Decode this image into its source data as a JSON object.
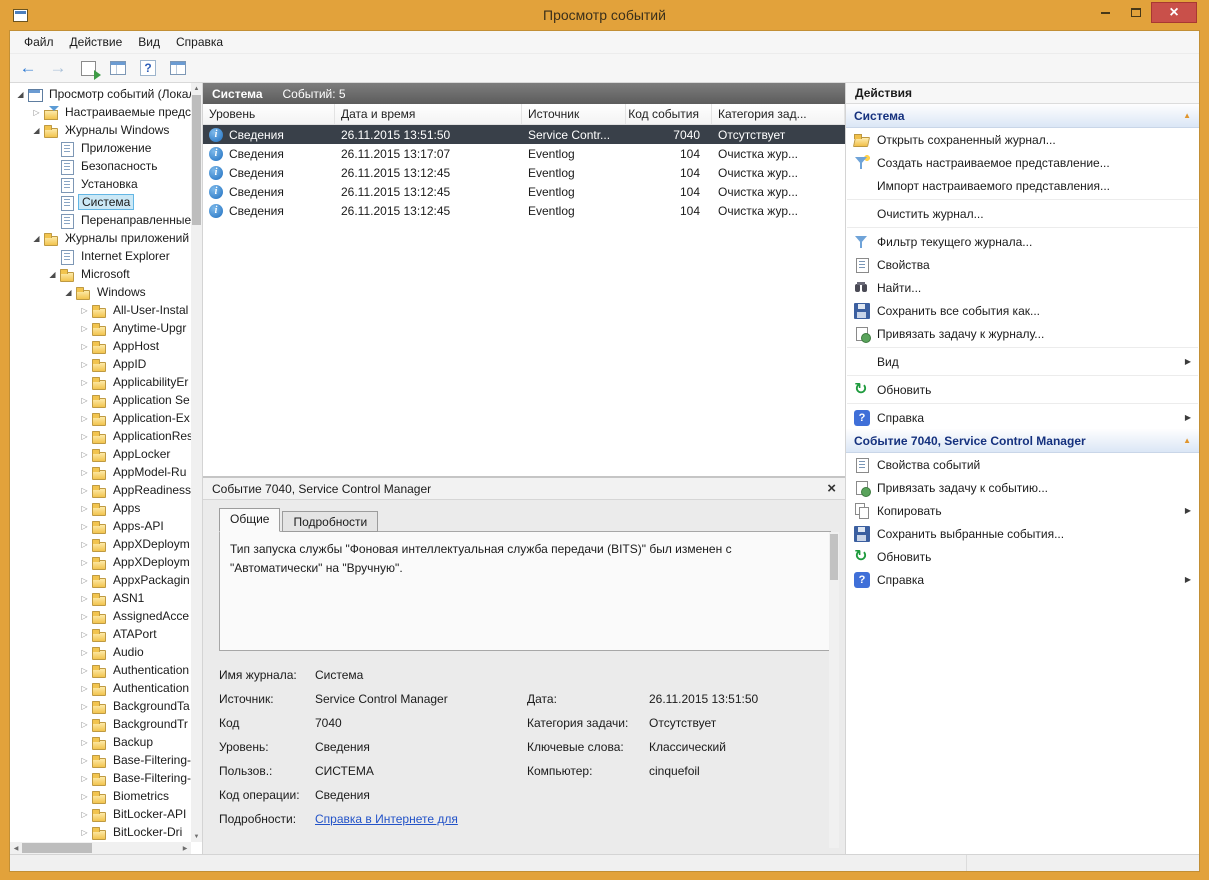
{
  "window": {
    "title": "Просмотр событий"
  },
  "menu": {
    "items": [
      "Файл",
      "Действие",
      "Вид",
      "Справка"
    ]
  },
  "icons": {
    "tree_expanded": "◢",
    "tree_collapsed": "▷",
    "submenu_arrow": "▶",
    "section_collapse": "▲",
    "scroll_up": "▲",
    "scroll_down": "▼",
    "scroll_left": "◀",
    "scroll_right": "▶"
  },
  "tree": {
    "items": [
      {
        "label": "Просмотр событий (Локальн",
        "level": 0,
        "arrow": "expanded",
        "icon": "event-viewer"
      },
      {
        "label": "Настраиваемые предста",
        "level": 1,
        "arrow": "collapsed",
        "icon": "custom-view"
      },
      {
        "label": "Журналы Windows",
        "level": 1,
        "arrow": "expanded",
        "icon": "folder"
      },
      {
        "label": "Приложение",
        "level": 2,
        "arrow": "none",
        "icon": "log"
      },
      {
        "label": "Безопасность",
        "level": 2,
        "arrow": "none",
        "icon": "log"
      },
      {
        "label": "Установка",
        "level": 2,
        "arrow": "none",
        "icon": "log"
      },
      {
        "label": "Система",
        "level": 2,
        "arrow": "none",
        "icon": "log",
        "selected": true
      },
      {
        "label": "Перенаправленные с",
        "level": 2,
        "arrow": "none",
        "icon": "log"
      },
      {
        "label": "Журналы приложений и",
        "level": 1,
        "arrow": "expanded",
        "icon": "folder"
      },
      {
        "label": "Internet Explorer",
        "level": 2,
        "arrow": "none",
        "icon": "log"
      },
      {
        "label": "Microsoft",
        "level": 2,
        "arrow": "expanded",
        "icon": "folder"
      },
      {
        "label": "Windows",
        "level": 3,
        "arrow": "expanded",
        "icon": "folder"
      },
      {
        "label": "All-User-Instal",
        "level": 4,
        "arrow": "collapsed",
        "icon": "folder"
      },
      {
        "label": "Anytime-Upgr",
        "level": 4,
        "arrow": "collapsed",
        "icon": "folder"
      },
      {
        "label": "AppHost",
        "level": 4,
        "arrow": "collapsed",
        "icon": "folder"
      },
      {
        "label": "AppID",
        "level": 4,
        "arrow": "collapsed",
        "icon": "folder"
      },
      {
        "label": "ApplicabilityEr",
        "level": 4,
        "arrow": "collapsed",
        "icon": "folder"
      },
      {
        "label": "Application Se",
        "level": 4,
        "arrow": "collapsed",
        "icon": "folder"
      },
      {
        "label": "Application-Ex",
        "level": 4,
        "arrow": "collapsed",
        "icon": "folder"
      },
      {
        "label": "ApplicationRes",
        "level": 4,
        "arrow": "collapsed",
        "icon": "folder"
      },
      {
        "label": "AppLocker",
        "level": 4,
        "arrow": "collapsed",
        "icon": "folder"
      },
      {
        "label": "AppModel-Ru",
        "level": 4,
        "arrow": "collapsed",
        "icon": "folder"
      },
      {
        "label": "AppReadiness",
        "level": 4,
        "arrow": "collapsed",
        "icon": "folder"
      },
      {
        "label": "Apps",
        "level": 4,
        "arrow": "collapsed",
        "icon": "folder"
      },
      {
        "label": "Apps-API",
        "level": 4,
        "arrow": "collapsed",
        "icon": "folder"
      },
      {
        "label": "AppXDeploym",
        "level": 4,
        "arrow": "collapsed",
        "icon": "folder"
      },
      {
        "label": "AppXDeploym",
        "level": 4,
        "arrow": "collapsed",
        "icon": "folder"
      },
      {
        "label": "AppxPackagin",
        "level": 4,
        "arrow": "collapsed",
        "icon": "folder"
      },
      {
        "label": "ASN1",
        "level": 4,
        "arrow": "collapsed",
        "icon": "folder"
      },
      {
        "label": "AssignedAcce",
        "level": 4,
        "arrow": "collapsed",
        "icon": "folder"
      },
      {
        "label": "ATAPort",
        "level": 4,
        "arrow": "collapsed",
        "icon": "folder"
      },
      {
        "label": "Audio",
        "level": 4,
        "arrow": "collapsed",
        "icon": "folder"
      },
      {
        "label": "Authentication",
        "level": 4,
        "arrow": "collapsed",
        "icon": "folder"
      },
      {
        "label": "Authentication",
        "level": 4,
        "arrow": "collapsed",
        "icon": "folder"
      },
      {
        "label": "BackgroundTa",
        "level": 4,
        "arrow": "collapsed",
        "icon": "folder"
      },
      {
        "label": "BackgroundTr",
        "level": 4,
        "arrow": "collapsed",
        "icon": "folder"
      },
      {
        "label": "Backup",
        "level": 4,
        "arrow": "collapsed",
        "icon": "folder"
      },
      {
        "label": "Base-Filtering-",
        "level": 4,
        "arrow": "collapsed",
        "icon": "folder"
      },
      {
        "label": "Base-Filtering-",
        "level": 4,
        "arrow": "collapsed",
        "icon": "folder"
      },
      {
        "label": "Biometrics",
        "level": 4,
        "arrow": "collapsed",
        "icon": "folder"
      },
      {
        "label": "BitLocker-API",
        "level": 4,
        "arrow": "collapsed",
        "icon": "folder"
      },
      {
        "label": "BitLocker-Dri",
        "level": 4,
        "arrow": "collapsed",
        "icon": "folder"
      }
    ]
  },
  "event_list": {
    "title": "Система",
    "count_label": "Событий: 5",
    "columns": [
      "Уровень",
      "Дата и время",
      "Источник",
      "Код события",
      "Категория зад..."
    ],
    "rows": [
      {
        "level": "Сведения",
        "datetime": "26.11.2015 13:51:50",
        "source": "Service Contr...",
        "event_id": "7040",
        "category": "Отсутствует",
        "selected": true
      },
      {
        "level": "Сведения",
        "datetime": "26.11.2015 13:17:07",
        "source": "Eventlog",
        "event_id": "104",
        "category": "Очистка жур...",
        "selected": false
      },
      {
        "level": "Сведения",
        "datetime": "26.11.2015 13:12:45",
        "source": "Eventlog",
        "event_id": "104",
        "category": "Очистка жур...",
        "selected": false
      },
      {
        "level": "Сведения",
        "datetime": "26.11.2015 13:12:45",
        "source": "Eventlog",
        "event_id": "104",
        "category": "Очистка жур...",
        "selected": false
      },
      {
        "level": "Сведения",
        "datetime": "26.11.2015 13:12:45",
        "source": "Eventlog",
        "event_id": "104",
        "category": "Очистка жур...",
        "selected": false
      }
    ]
  },
  "details": {
    "title": "Событие 7040, Service Control Manager",
    "tabs": [
      {
        "label": "Общие",
        "active": true
      },
      {
        "label": "Подробности",
        "active": false
      }
    ],
    "description": "Тип запуска службы \"Фоновая интеллектуальная служба передачи (BITS)\" был изменен с \"Автоматически\" на \"Вручную\".",
    "fields": [
      {
        "label": "Имя журнала:",
        "value": "Система",
        "label2": "",
        "value2": ""
      },
      {
        "label": "Источник:",
        "value": "Service Control Manager",
        "label2": "Дата:",
        "value2": "26.11.2015 13:51:50"
      },
      {
        "label": "Код",
        "value": "7040",
        "label2": "Категория задачи:",
        "value2": "Отсутствует"
      },
      {
        "label": "Уровень:",
        "value": "Сведения",
        "label2": "Ключевые слова:",
        "value2": "Классический"
      },
      {
        "label": "Пользов.:",
        "value": "СИСТЕМА",
        "label2": "Компьютер:",
        "value2": "cinquefoil"
      },
      {
        "label": "Код операции:",
        "value": "Сведения",
        "label2": "",
        "value2": ""
      },
      {
        "label": "Подробности:",
        "value": "Справка в Интернете для",
        "link": true,
        "label2": "",
        "value2": ""
      }
    ]
  },
  "actions": {
    "title": "Действия",
    "sections": [
      {
        "header": "Система",
        "items": [
          {
            "label": "Открыть сохраненный журнал...",
            "icon": "open-folder"
          },
          {
            "label": "Создать настраиваемое представление...",
            "icon": "create-view"
          },
          {
            "label": "Импорт настраиваемого представления...",
            "icon": "none"
          },
          {
            "separator": true
          },
          {
            "label": "Очистить журнал...",
            "icon": "none"
          },
          {
            "separator": true
          },
          {
            "label": "Фильтр текущего журнала...",
            "icon": "filter"
          },
          {
            "label": "Свойства",
            "icon": "properties"
          },
          {
            "label": "Найти...",
            "icon": "find"
          },
          {
            "label": "Сохранить все события как...",
            "icon": "save"
          },
          {
            "label": "Привязать задачу к журналу...",
            "icon": "task"
          },
          {
            "separator": true
          },
          {
            "label": "Вид",
            "icon": "none",
            "submenu": true
          },
          {
            "separator": true
          },
          {
            "label": "Обновить",
            "icon": "refresh"
          },
          {
            "separator": true
          },
          {
            "label": "Справка",
            "icon": "help",
            "submenu": true
          }
        ]
      },
      {
        "header": "Событие 7040, Service Control Manager",
        "items": [
          {
            "label": "Свойства событий",
            "icon": "properties"
          },
          {
            "label": "Привязать задачу к событию...",
            "icon": "task"
          },
          {
            "label": "Копировать",
            "icon": "copy",
            "submenu": true
          },
          {
            "label": "Сохранить выбранные события...",
            "icon": "save"
          },
          {
            "label": "Обновить",
            "icon": "refresh"
          },
          {
            "label": "Справка",
            "icon": "help",
            "submenu": true
          }
        ]
      }
    ]
  }
}
